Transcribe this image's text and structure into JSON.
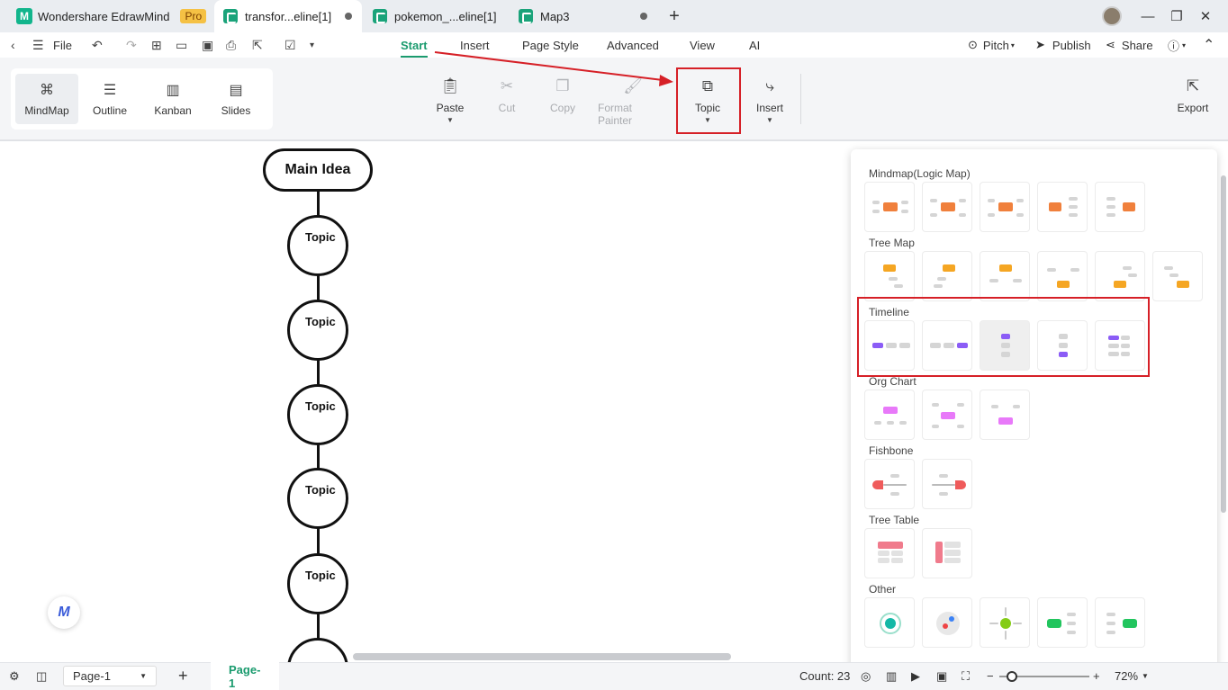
{
  "tabs": {
    "app_title": "Wondershare EdrawMind",
    "pro_badge": "Pro",
    "tab1": "transfor...eline[1]",
    "tab2": "pokemon_...eline[1]",
    "tab3": "Map3",
    "new_tab": "+"
  },
  "window": {
    "minimize": "—",
    "restore": "❐",
    "close": "✕"
  },
  "menu": {
    "file": "File",
    "start": "Start",
    "insert": "Insert",
    "page_style": "Page Style",
    "advanced": "Advanced",
    "view": "View",
    "ai": "AI",
    "pitch": "Pitch",
    "publish": "Publish",
    "share": "Share"
  },
  "views": {
    "mindmap": "MindMap",
    "outline": "Outline",
    "kanban": "Kanban",
    "slides": "Slides"
  },
  "ribbon": {
    "paste": "Paste",
    "cut": "Cut",
    "copy": "Copy",
    "format_painter": "Format Painter",
    "topic": "Topic",
    "insert": "Insert",
    "export": "Export"
  },
  "canvas": {
    "main_idea": "Main Idea",
    "topics": [
      "Topic",
      "Topic",
      "Topic",
      "Topic",
      "Topic"
    ]
  },
  "panel": {
    "mindmap": "Mindmap(Logic Map)",
    "tree_map": "Tree Map",
    "timeline": "Timeline",
    "org_chart": "Org Chart",
    "fishbone": "Fishbone",
    "tree_table": "Tree Table",
    "other": "Other"
  },
  "status": {
    "page_select": "Page-1",
    "page_tab": "Page-1",
    "count": "Count: 23",
    "zoom": "72%"
  },
  "colors": {
    "accent": "#1a9b6e",
    "highlight": "#d62027"
  }
}
